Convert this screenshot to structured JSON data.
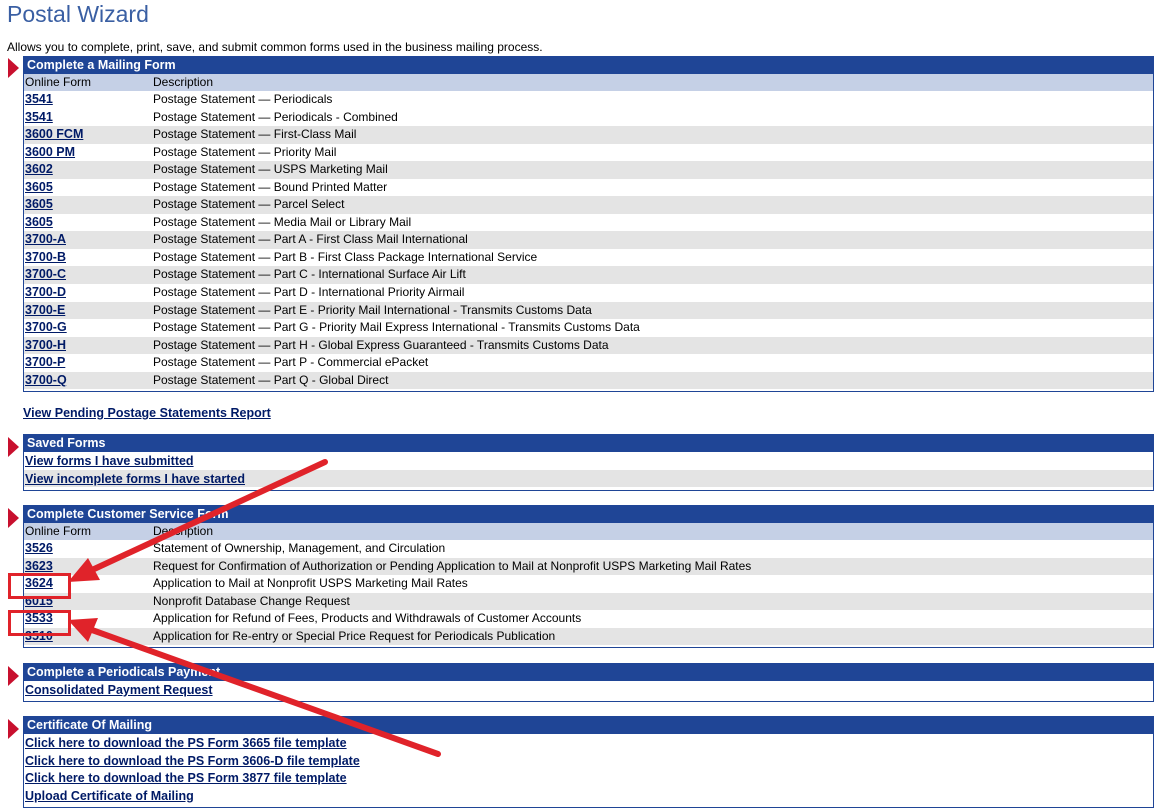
{
  "page": {
    "title": "Postal Wizard",
    "intro": "Allows you to complete, print, save, and submit common forms used in the business mailing process."
  },
  "mailing_form": {
    "header": "Complete a Mailing Form",
    "col_form": "Online Form",
    "col_desc": "Description",
    "rows": [
      {
        "form": "3541",
        "desc": "Postage Statement — Periodicals"
      },
      {
        "form": "3541",
        "desc": "Postage Statement — Periodicals - Combined"
      },
      {
        "form": "3600 FCM",
        "desc": "Postage Statement — First-Class Mail"
      },
      {
        "form": "3600 PM",
        "desc": "Postage Statement — Priority Mail"
      },
      {
        "form": "3602",
        "desc": "Postage Statement — USPS Marketing Mail"
      },
      {
        "form": "3605",
        "desc": "Postage Statement — Bound Printed Matter"
      },
      {
        "form": "3605",
        "desc": "Postage Statement — Parcel Select"
      },
      {
        "form": "3605",
        "desc": "Postage Statement — Media Mail or Library Mail"
      },
      {
        "form": "3700-A",
        "desc": "Postage Statement — Part A - First Class Mail International"
      },
      {
        "form": "3700-B",
        "desc": "Postage Statement — Part B - First Class Package International Service"
      },
      {
        "form": "3700-C",
        "desc": "Postage Statement — Part C - International Surface Air Lift"
      },
      {
        "form": "3700-D",
        "desc": "Postage Statement — Part D - International Priority Airmail"
      },
      {
        "form": "3700-E",
        "desc": "Postage Statement — Part E - Priority Mail International - Transmits Customs Data"
      },
      {
        "form": "3700-G",
        "desc": "Postage Statement — Part G - Priority Mail Express International - Transmits Customs Data"
      },
      {
        "form": "3700-H",
        "desc": "Postage Statement — Part H - Global Express Guaranteed - Transmits Customs Data"
      },
      {
        "form": "3700-P",
        "desc": "Postage Statement — Part P - Commercial ePacket"
      },
      {
        "form": "3700-Q",
        "desc": "Postage Statement — Part Q - Global Direct"
      }
    ]
  },
  "pending_link": "View Pending Postage Statements Report",
  "saved_forms": {
    "header": "Saved Forms",
    "links": [
      "View forms I have submitted",
      "View incomplete forms I have started"
    ]
  },
  "customer_service": {
    "header": "Complete Customer Service Form",
    "col_form": "Online Form",
    "col_desc": "Description",
    "rows": [
      {
        "form": "3526",
        "desc": "Statement of Ownership, Management, and Circulation"
      },
      {
        "form": "3623",
        "desc": "Request for Confirmation of Authorization or Pending Application to Mail at Nonprofit USPS Marketing Mail Rates"
      },
      {
        "form": "3624",
        "desc": "Application to Mail at Nonprofit USPS Marketing Mail Rates"
      },
      {
        "form": "6015",
        "desc": "Nonprofit Database Change Request"
      },
      {
        "form": "3533",
        "desc": "Application for Refund of Fees, Products and Withdrawals of Customer Accounts"
      },
      {
        "form": "3510",
        "desc": "Application for Re-entry or Special Price Request for Periodicals Publication"
      }
    ]
  },
  "periodicals": {
    "header": "Complete a Periodicals Payment",
    "links": [
      "Consolidated Payment Request"
    ]
  },
  "certificate": {
    "header": "Certificate Of Mailing",
    "links": [
      "Click here to download the PS Form 3665 file template",
      "Click here to download the PS Form 3606-D file template",
      "Click here to download the PS Form 3877 file template",
      "Upload Certificate of Mailing"
    ]
  },
  "colors": {
    "header_blue": "#1f4596",
    "column_header": "#c5d0e6",
    "row_alt": "#e4e4e4",
    "annotation_red": "#e0232a",
    "pin_red": "#c8102e"
  }
}
